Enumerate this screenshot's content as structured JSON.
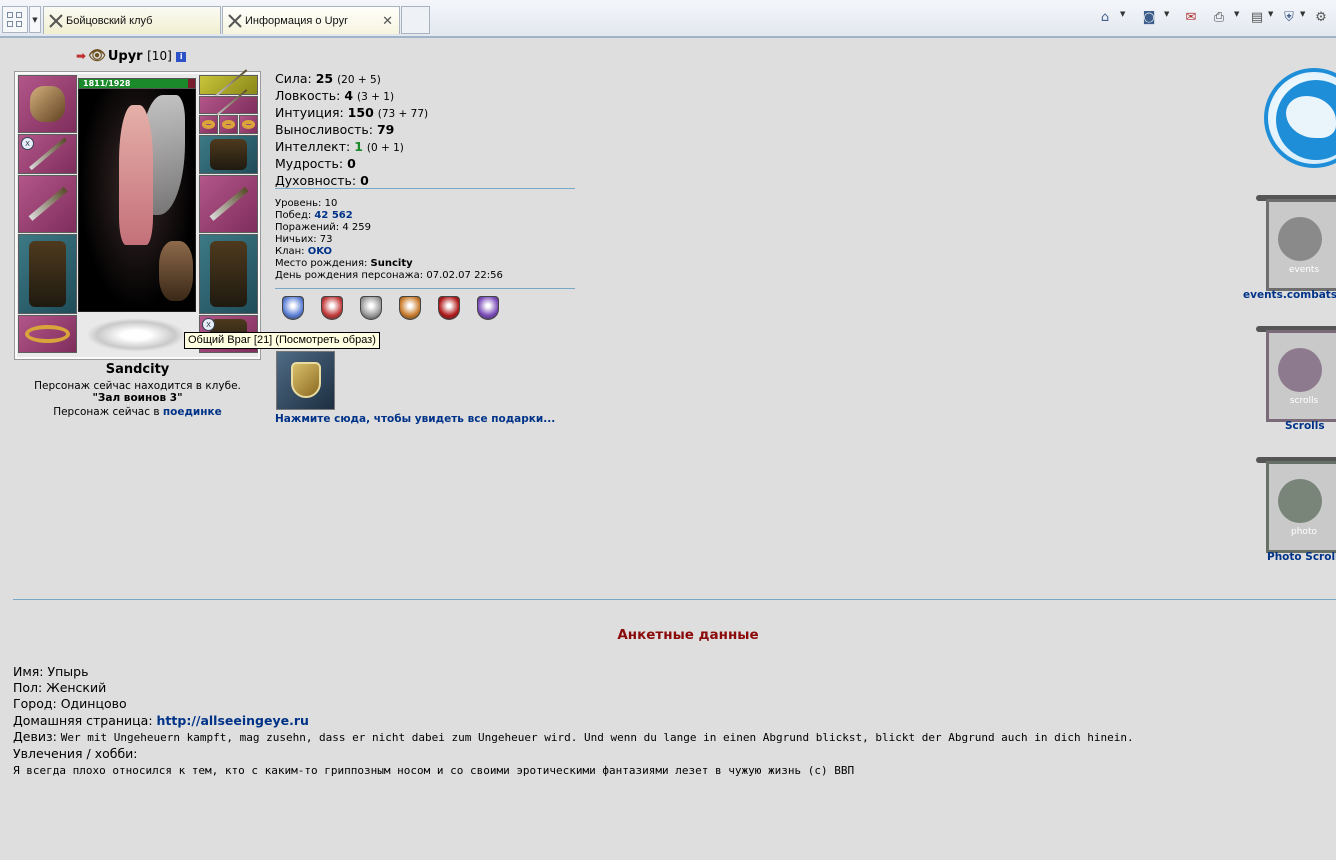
{
  "browser": {
    "tabs": [
      {
        "label": "Бойцовский клуб"
      },
      {
        "label": "Информация о Upyr"
      }
    ],
    "toolbar_icons": [
      "home-icon",
      "rss-icon",
      "mail-icon",
      "print-icon",
      "page-icon",
      "security-icon",
      "gear-icon"
    ]
  },
  "character": {
    "name": "Upyr",
    "level": "[10]",
    "hp": "1811/1928",
    "hp_fraction": 0.94,
    "tooltip": "Общий Враг [21] (Посмотреть образ)",
    "city": "Sandcity",
    "location_line": "Персонаж сейчас находится в клубе.",
    "location_room": "\"Зал воинов 3\"",
    "fight_prefix": "Персонаж сейчас в ",
    "fight_link": "поединке"
  },
  "stats": [
    {
      "label": "Сила: ",
      "value": "25",
      "extra": "(20 + 5)",
      "accent": ""
    },
    {
      "label": "Ловкость: ",
      "value": "4",
      "extra": "(3 + 1)",
      "accent": ""
    },
    {
      "label": "Интуиция: ",
      "value": "150",
      "extra": "(73 + 77)",
      "accent": ""
    },
    {
      "label": "Выносливость: ",
      "value": "79",
      "extra": "",
      "accent": ""
    },
    {
      "label": "Интеллект: ",
      "value": "1",
      "extra": "(0 + 1)",
      "accent": "green"
    },
    {
      "label": "Мудрость: ",
      "value": "0",
      "extra": "",
      "accent": ""
    },
    {
      "label": "Духовность: ",
      "value": "0",
      "extra": "",
      "accent": ""
    }
  ],
  "info": {
    "level_label": "Уровень: ",
    "level_value": "10",
    "wins_label": "Побед: ",
    "wins_value": "42 562",
    "losses_label": "Поражений: ",
    "losses_value": "4 259",
    "draws_label": "Ничьих: ",
    "draws_value": "73",
    "clan_label": "Клан: ",
    "clan_value": "OKO",
    "birthplace_label": "Место рождения: ",
    "birthplace_value": "Suncity",
    "birthday_label": "День рождения персонажа: ",
    "birthday_value": "07.02.07 22:56"
  },
  "medals": [
    {
      "color": "#5a7ed6"
    },
    {
      "color": "#c23a3a"
    },
    {
      "color": "#9a9a9a"
    },
    {
      "color": "#c87a2a"
    },
    {
      "color": "#b01818"
    },
    {
      "color": "#7a4ab8"
    }
  ],
  "gifts": {
    "link": "Нажмите сюда, чтобы увидеть все подарки..."
  },
  "banners": [
    {
      "word": "events",
      "label": "events.combats"
    },
    {
      "word": "scrolls",
      "label": "Scrolls"
    },
    {
      "word": "photo",
      "label": "Photo Scrolls"
    }
  ],
  "profile": {
    "title": "Анкетные данные",
    "name_label": "Имя: ",
    "name_value": "Упырь",
    "sex_label": "Пол: ",
    "sex_value": "Женский",
    "city_label": "Город: ",
    "city_value": "Одинцово",
    "homepage_label": "Домашняя страница: ",
    "homepage_value": "http://allseeingeye.ru",
    "motto_label": "Девиз: ",
    "motto_value": "Wer mit Ungeheuern kampft, mag zusehn, dass er nicht dabei zum Ungeheuer wird. Und wenn du lange in einen Abgrund blickst, blickt der Abgrund auch in dich hinein.",
    "hobby_label": "Увлечения / хобби:",
    "hobby_value": "Я всегда плохо относился к тем, кто с каким-то гриппозным носом и со своими эротическими фантазиями лезет в чужую жизнь (с) ВВП"
  }
}
